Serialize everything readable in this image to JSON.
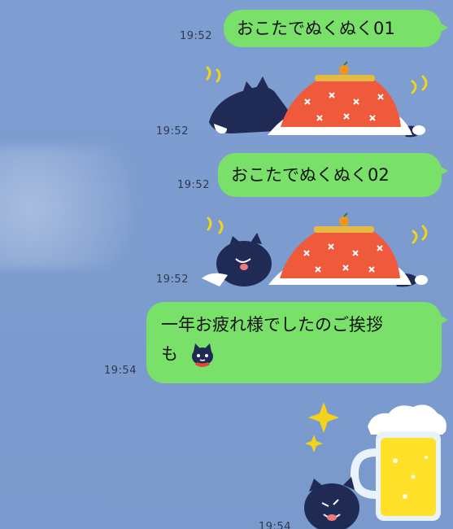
{
  "chat": {
    "background_color": "#7d9ccf",
    "bubble_color": "#79e169",
    "messages": [
      {
        "type": "text",
        "text": "おこたでぬくぬく01",
        "time": "19:52"
      },
      {
        "type": "sticker",
        "icon": "black-cat-kotatsu-sticker",
        "time": "19:52"
      },
      {
        "type": "text",
        "text": "おこたでぬくぬく02",
        "time": "19:52"
      },
      {
        "type": "sticker",
        "icon": "black-cat-kotatsu-sticker",
        "time": "19:52"
      },
      {
        "type": "text",
        "line1": "一年お疲れ様でしたのご挨拶",
        "line2": "も",
        "emoji": "black-cat-emoji",
        "time": "19:54"
      },
      {
        "type": "sticker",
        "icon": "black-cat-beer-sticker",
        "time": "19:54"
      }
    ]
  }
}
